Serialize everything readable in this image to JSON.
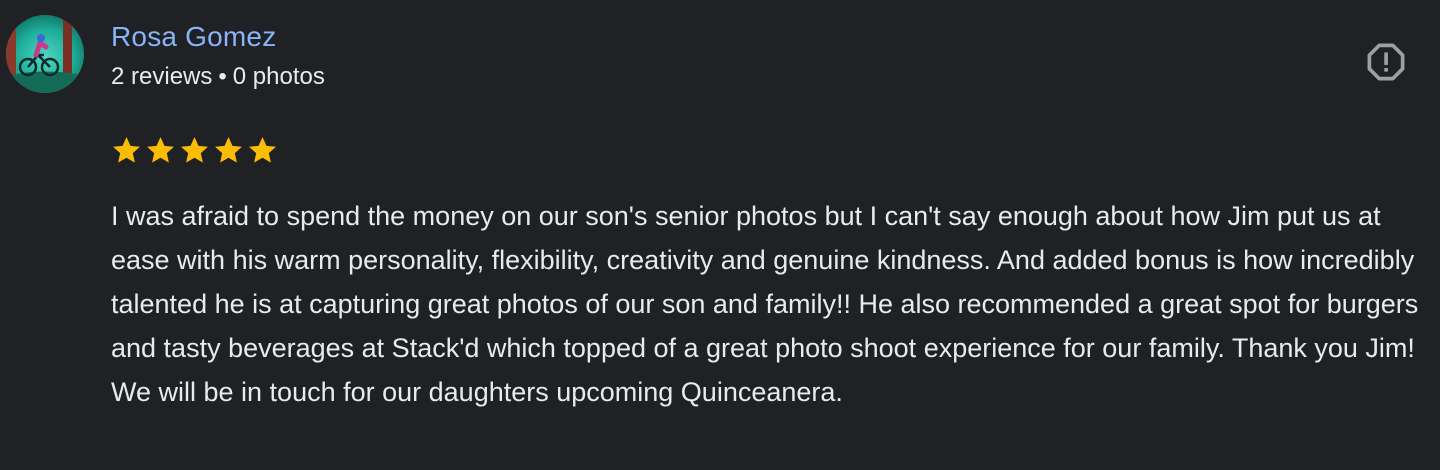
{
  "review": {
    "author": {
      "name": "Rosa Gomez",
      "reviews_count": "2 reviews",
      "separator": "•",
      "photos_count": "0 photos",
      "avatar_icon": "cyclist-avatar"
    },
    "rating": {
      "value": 5,
      "max": 5,
      "color": "#fbbc04"
    },
    "report_icon": "report-octagon-icon",
    "text": "I was afraid to spend the money on our son's senior photos but I can't say enough about how Jim put us at ease with his warm personality, flexibility, creativity and genuine kindness. And added bonus is how incredibly talented he is at capturing great photos of our son and family!! He also recommended a great spot for burgers and tasty beverages at Stack'd which topped of a great photo shoot experience for our family. Thank you Jim! We will be in touch for our daughters upcoming Quinceanera."
  },
  "colors": {
    "background": "#202124",
    "name_link": "#8ab4f8",
    "text": "#e8eaed",
    "icon": "#9aa0a6"
  }
}
